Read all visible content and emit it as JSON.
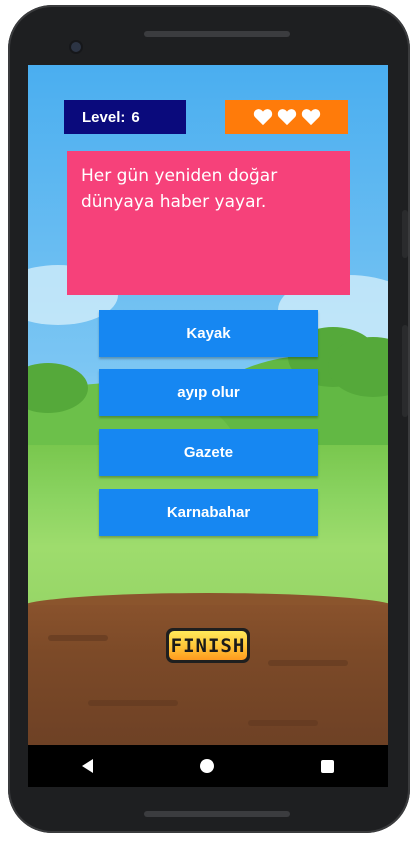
{
  "hud": {
    "level_label": "Level:",
    "level_value": "6",
    "lives_count": 3,
    "lives_icon": "heart-icon",
    "lives_color": "#ff7b0a",
    "level_color": "#0a0a7c"
  },
  "question": {
    "text": "Her gün yeniden doğar dünyaya haber yayar.",
    "card_color": "#f6417a"
  },
  "answers": [
    {
      "label": "Kayak"
    },
    {
      "label": "ayıp olur"
    },
    {
      "label": "Gazete"
    },
    {
      "label": "Karnabahar"
    }
  ],
  "answer_color": "#1687f2",
  "finish": {
    "label": "FINISH"
  },
  "navbar": {
    "back_icon": "back-triangle-icon",
    "home_icon": "home-circle-icon",
    "recent_icon": "recent-square-icon"
  }
}
